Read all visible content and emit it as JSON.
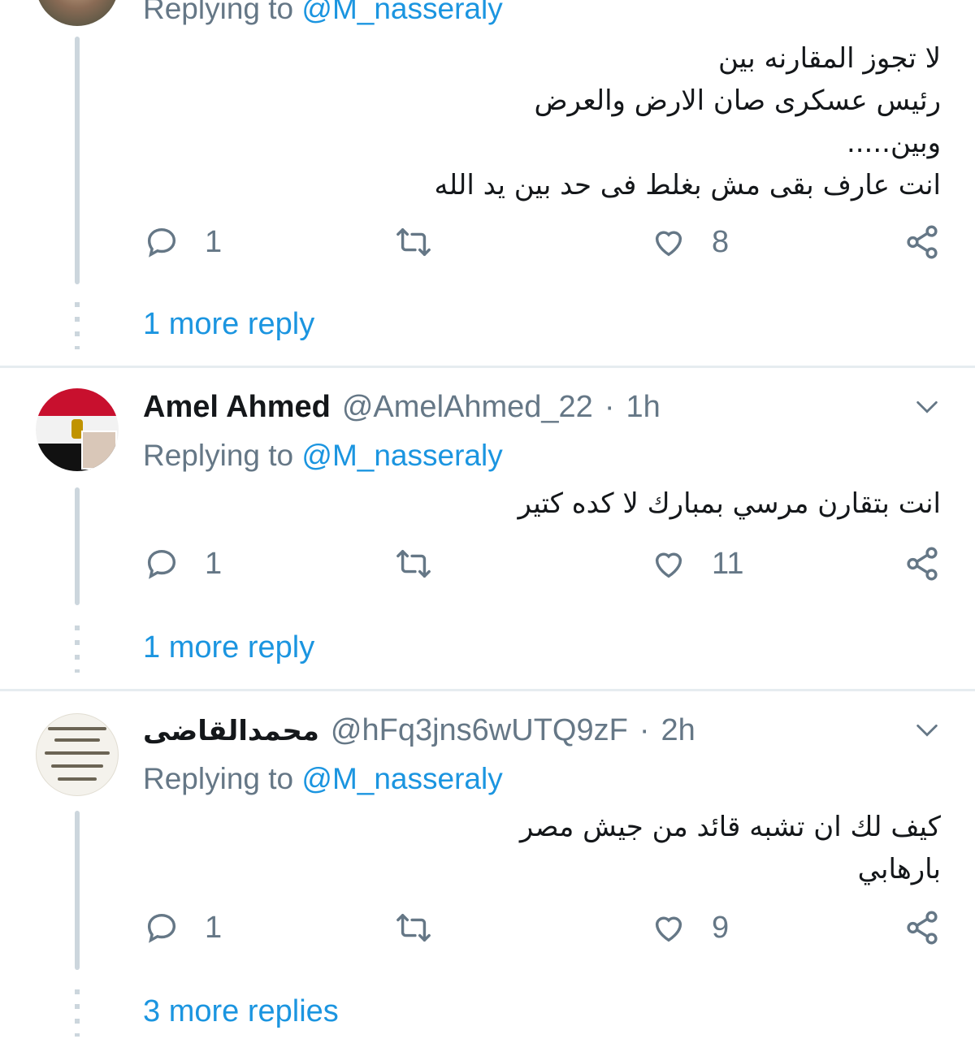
{
  "colors": {
    "link": "#1b95e0",
    "muted": "#657786",
    "text": "#14171a",
    "line": "#ccd6dd"
  },
  "tweet0": {
    "replying_label": "Replying to",
    "replying_handle": "@M_nasseraly",
    "text": "لا تجوز المقارنه بين\nرئيس عسكرى صان الارض والعرض\nوبين.....\nانت عارف بقى مش بغلط فى حد بين يد الله",
    "reply_count": "1",
    "like_count": "8",
    "more_replies": "1 more reply"
  },
  "tweet1": {
    "name": "Amel Ahmed",
    "handle": "@AmelAhmed_22",
    "sep": "·",
    "time": "1h",
    "replying_label": "Replying to",
    "replying_handle": "@M_nasseraly",
    "text": "انت بتقارن مرسي بمبارك لا كده كتير",
    "reply_count": "1",
    "like_count": "11",
    "more_replies": "1 more reply"
  },
  "tweet2": {
    "name": "محمدالقاضى",
    "handle": "@hFq3jns6wUTQ9zF",
    "sep": "·",
    "time": "2h",
    "replying_label": "Replying to",
    "replying_handle": "@M_nasseraly",
    "text": "كيف لك ان تشبه قائد من جيش مصر\nبارهابي",
    "reply_count": "1",
    "like_count": "9",
    "more_replies": "3 more replies"
  },
  "icons": {
    "reply": "reply-icon",
    "retweet": "retweet-icon",
    "like": "heart-icon",
    "share": "share-icon",
    "more": "chevron-down-icon"
  }
}
